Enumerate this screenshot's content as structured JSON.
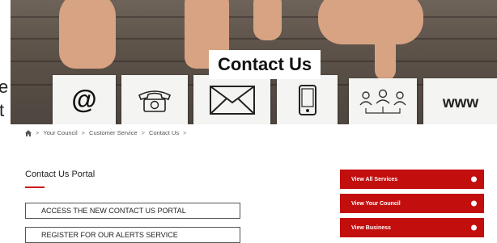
{
  "hero": {
    "title": "Contact Us",
    "cards": [
      {
        "icon": "at-sign-icon",
        "label": ""
      },
      {
        "icon": "telephone-icon",
        "label": ""
      },
      {
        "icon": "envelope-icon",
        "label": ""
      },
      {
        "icon": "mobile-phone-icon",
        "label": ""
      },
      {
        "icon": "people-network-icon",
        "label": ""
      },
      {
        "icon": "www-icon",
        "label": "www"
      }
    ]
  },
  "left_cut_text": {
    "line1": "e",
    "line2": "t"
  },
  "breadcrumb": {
    "home_icon": "home-icon",
    "items": [
      "Your Council",
      "Customer Service",
      "Contact Us"
    ]
  },
  "portal": {
    "title": "Contact Us Portal",
    "buttons": [
      "ACCESS THE NEW CONTACT US PORTAL",
      "REGISTER FOR OUR ALERTS SERVICE"
    ]
  },
  "side_menu": {
    "items": [
      "View All Services",
      "View Your Council",
      "View Business"
    ]
  },
  "colors": {
    "accent_red": "#c30e0e",
    "hero_title_bg": "#ffffff"
  }
}
